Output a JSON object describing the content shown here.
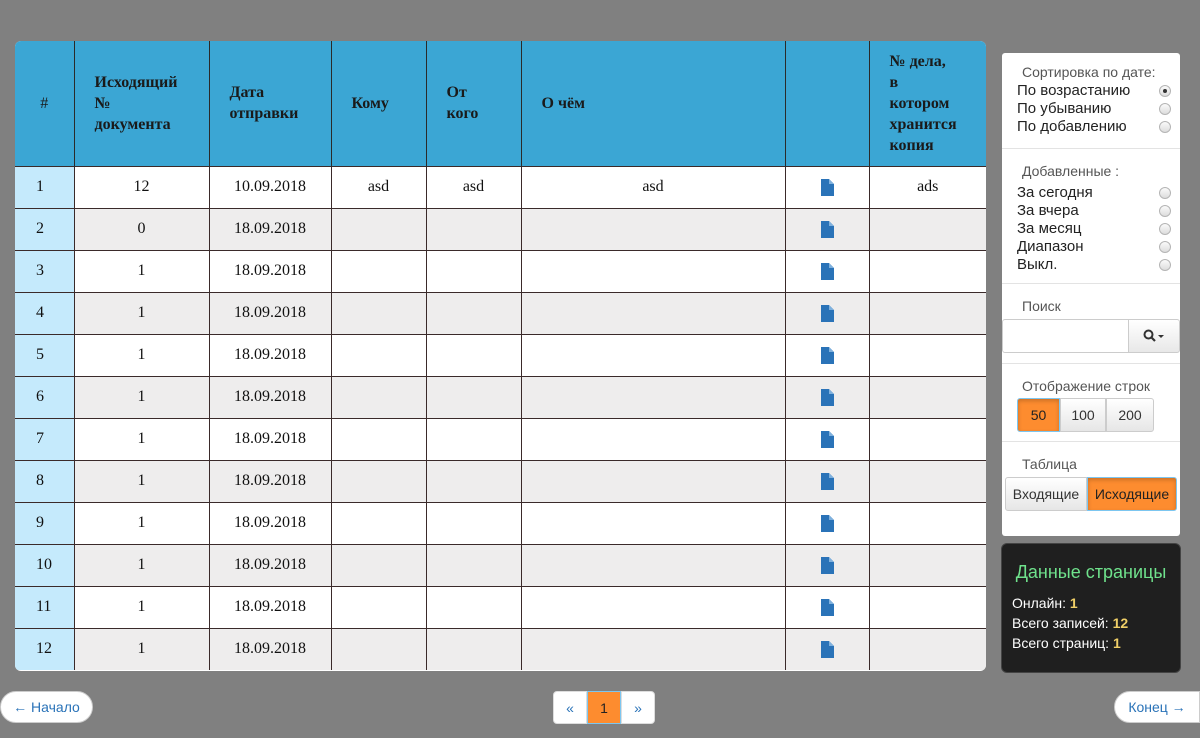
{
  "table": {
    "headers": [
      "#",
      "Исходящий № документа",
      "Дата отправки",
      "Кому",
      "От кого",
      "О чём",
      "",
      "№ дела, в котором хранится копия"
    ],
    "header_lines": [
      [
        "#"
      ],
      [
        "Исходящий",
        "№",
        "документа"
      ],
      [
        "Дата",
        "отправки"
      ],
      [
        "Кому"
      ],
      [
        "От",
        "кого"
      ],
      [
        "О чём"
      ],
      [
        ""
      ],
      [
        "№ дела,",
        "в",
        "котором",
        "хранится",
        "копия"
      ]
    ],
    "rows": [
      {
        "num": "1",
        "doc_no": "12",
        "date": "10.09.2018",
        "to": "asd",
        "from": "asd",
        "about": "asd",
        "file_icon": "document-icon",
        "case_no": "ads"
      },
      {
        "num": "2",
        "doc_no": "0",
        "date": "18.09.2018",
        "to": "",
        "from": "",
        "about": "",
        "file_icon": "document-icon",
        "case_no": ""
      },
      {
        "num": "3",
        "doc_no": "1",
        "date": "18.09.2018",
        "to": "",
        "from": "",
        "about": "",
        "file_icon": "document-icon",
        "case_no": ""
      },
      {
        "num": "4",
        "doc_no": "1",
        "date": "18.09.2018",
        "to": "",
        "from": "",
        "about": "",
        "file_icon": "document-icon",
        "case_no": ""
      },
      {
        "num": "5",
        "doc_no": "1",
        "date": "18.09.2018",
        "to": "",
        "from": "",
        "about": "",
        "file_icon": "document-icon",
        "case_no": ""
      },
      {
        "num": "6",
        "doc_no": "1",
        "date": "18.09.2018",
        "to": "",
        "from": "",
        "about": "",
        "file_icon": "document-icon",
        "case_no": ""
      },
      {
        "num": "7",
        "doc_no": "1",
        "date": "18.09.2018",
        "to": "",
        "from": "",
        "about": "",
        "file_icon": "document-icon",
        "case_no": ""
      },
      {
        "num": "8",
        "doc_no": "1",
        "date": "18.09.2018",
        "to": "",
        "from": "",
        "about": "",
        "file_icon": "document-icon",
        "case_no": ""
      },
      {
        "num": "9",
        "doc_no": "1",
        "date": "18.09.2018",
        "to": "",
        "from": "",
        "about": "",
        "file_icon": "document-icon",
        "case_no": ""
      },
      {
        "num": "10",
        "doc_no": "1",
        "date": "18.09.2018",
        "to": "",
        "from": "",
        "about": "",
        "file_icon": "document-icon",
        "case_no": ""
      },
      {
        "num": "11",
        "doc_no": "1",
        "date": "18.09.2018",
        "to": "",
        "from": "",
        "about": "",
        "file_icon": "document-icon",
        "case_no": ""
      },
      {
        "num": "12",
        "doc_no": "1",
        "date": "18.09.2018",
        "to": "",
        "from": "",
        "about": "",
        "file_icon": "document-icon",
        "case_no": ""
      }
    ]
  },
  "sidebar": {
    "sort": {
      "title": "Сортировка по дате:",
      "options": [
        {
          "label": "По возрастанию",
          "checked": true
        },
        {
          "label": "По убыванию",
          "checked": false
        },
        {
          "label": "По добавлению",
          "checked": false
        }
      ]
    },
    "added": {
      "title": "Добавленные :",
      "options": [
        {
          "label": "За сегодня",
          "checked": false
        },
        {
          "label": "За вчера",
          "checked": false
        },
        {
          "label": "За месяц",
          "checked": false
        },
        {
          "label": "Диапазон",
          "checked": false
        },
        {
          "label": "Выкл.",
          "checked": false
        }
      ]
    },
    "search": {
      "title": "Поиск",
      "value": "",
      "placeholder": "",
      "icon": "search-icon"
    },
    "rows_display": {
      "title": "Отображение строк",
      "options": [
        "50",
        "100",
        "200"
      ],
      "selected": "50"
    },
    "table_type": {
      "title": "Таблица",
      "options": [
        "Входящие",
        "Исходящие"
      ],
      "selected": "Исходящие"
    }
  },
  "info": {
    "title": "Данные страницы",
    "lines": [
      {
        "label": "Онлайн:",
        "value": "1"
      },
      {
        "label": "Всего записей:",
        "value": "12"
      },
      {
        "label": "Всего страниц:",
        "value": "1"
      }
    ]
  },
  "nav": {
    "start_label": "← Начало",
    "end_label": "Конец →",
    "pager": {
      "prev": "«",
      "pages": [
        "1"
      ],
      "current": "1",
      "next": "»"
    }
  },
  "colors": {
    "header_bg": "#3ba6d4",
    "accent": "#fd8c2f",
    "index_cell_bg": "#c5eafc",
    "info_title": "#6fe28c",
    "info_value": "#f0cf67",
    "link": "#2a73b8"
  }
}
